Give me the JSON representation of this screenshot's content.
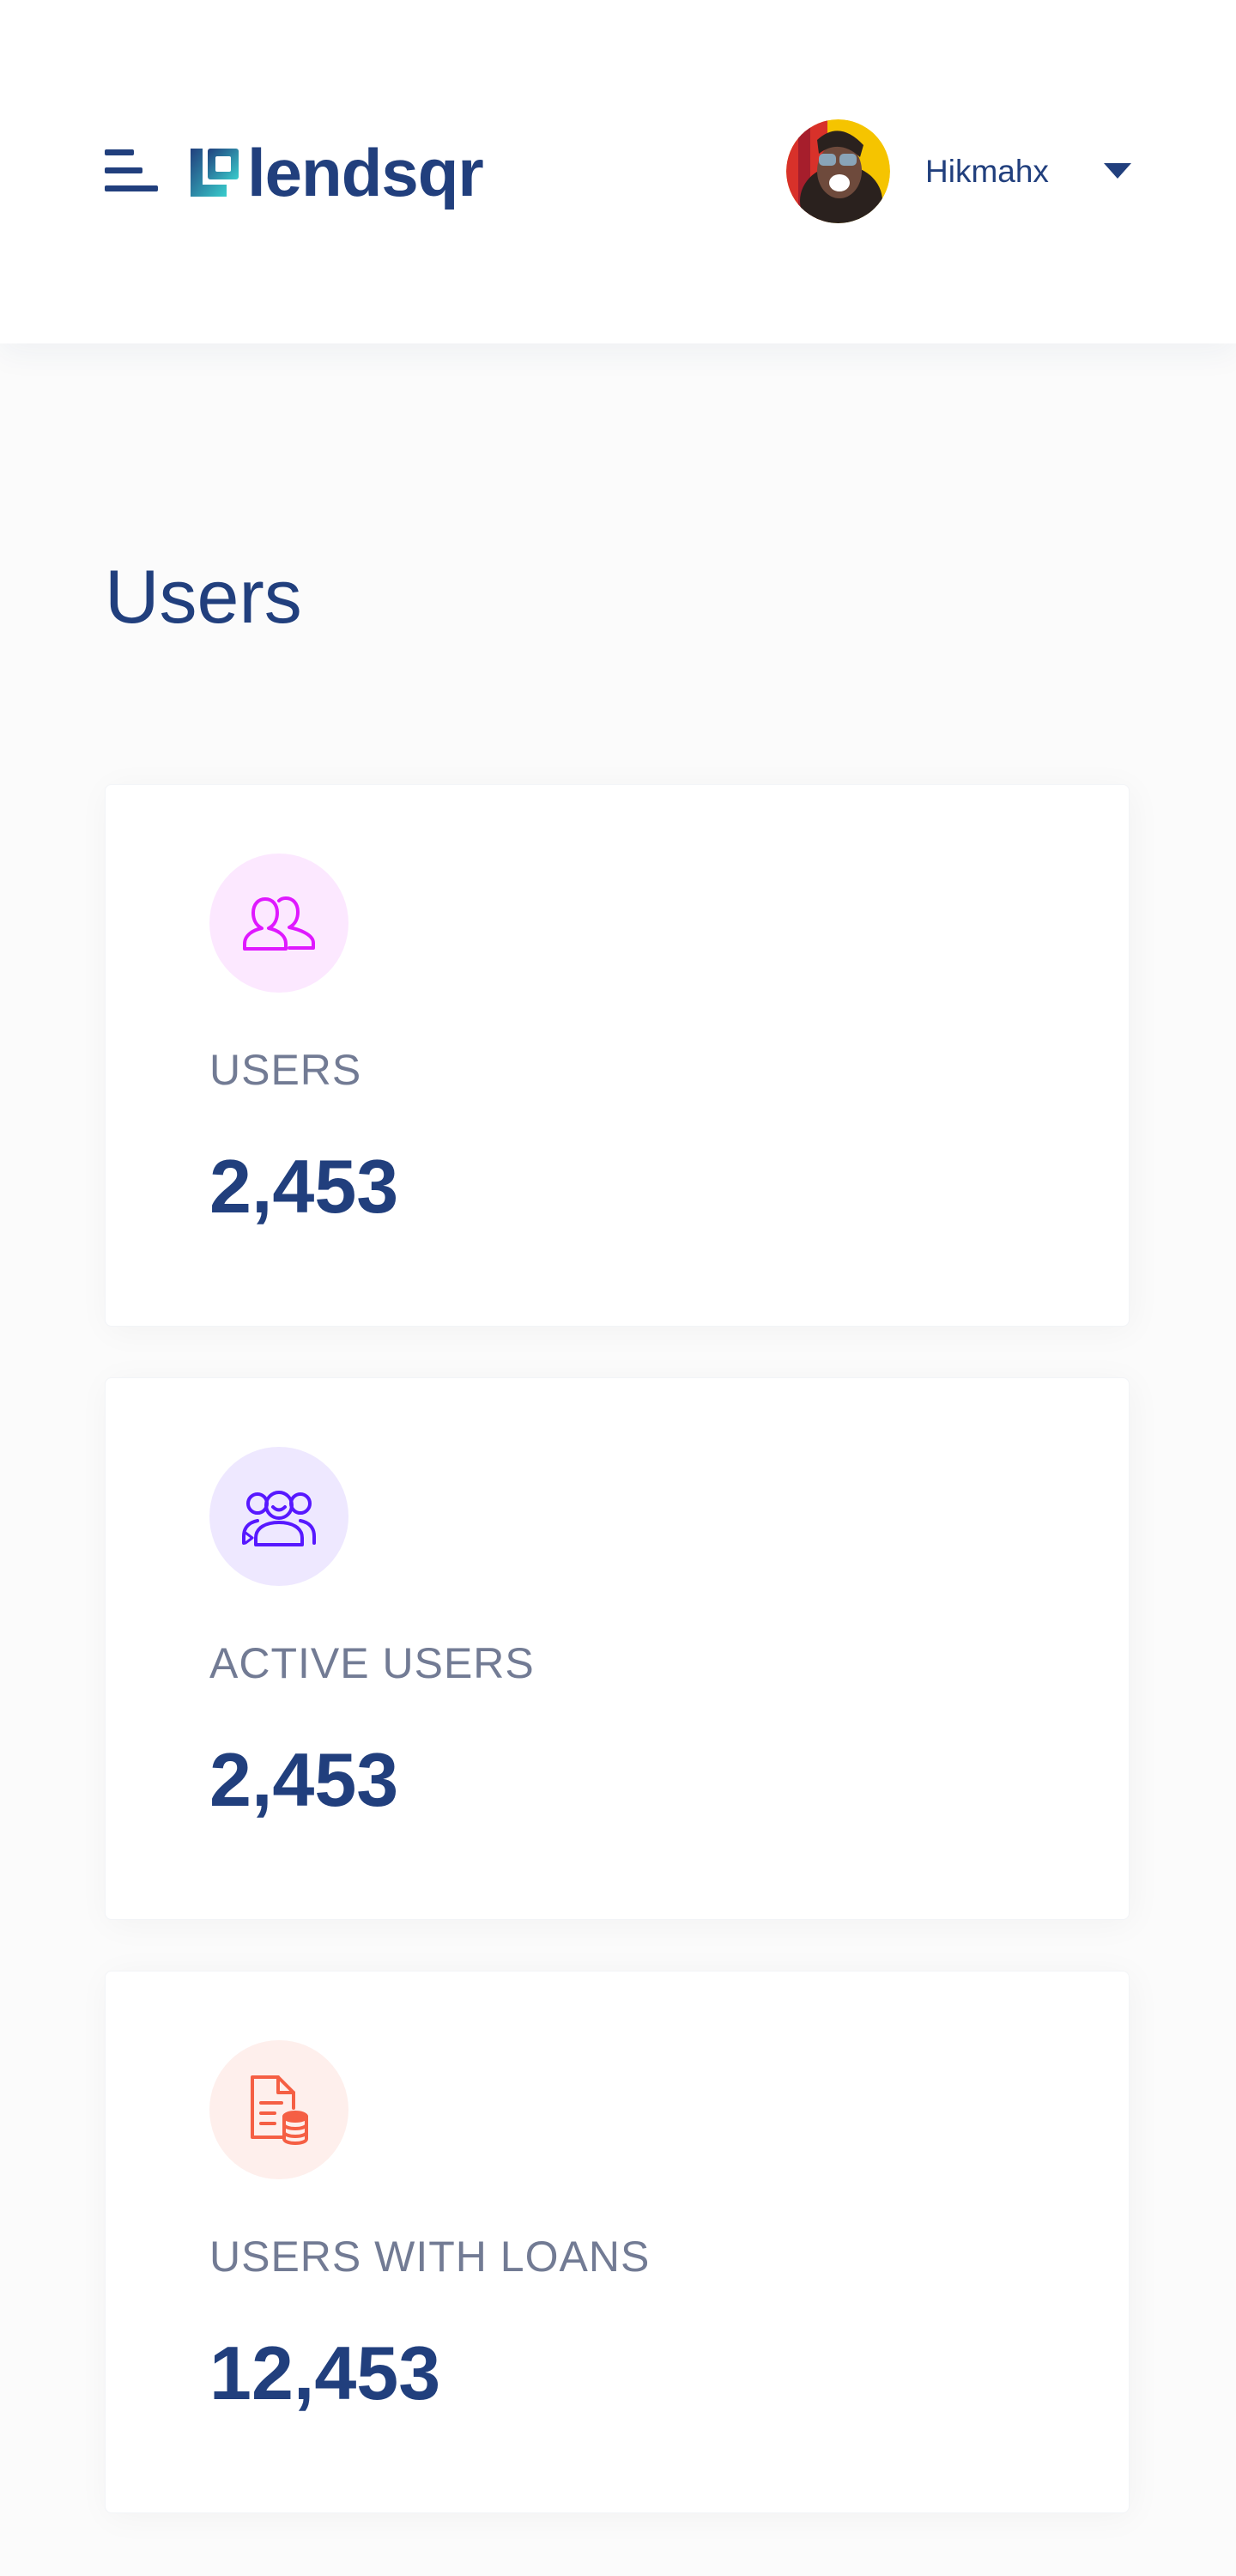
{
  "header": {
    "brand": "lendsqr",
    "user": {
      "name": "Hikmahx"
    }
  },
  "page": {
    "title": "Users"
  },
  "stats": [
    {
      "label": "USERS",
      "value": "2,453",
      "icon": "users-icon",
      "icon_color": "#DF18FF",
      "icon_bg": "#FCE8FF"
    },
    {
      "label": "ACTIVE USERS",
      "value": "2,453",
      "icon": "active-users-icon",
      "icon_color": "#5718FF",
      "icon_bg": "#EEE8FF"
    },
    {
      "label": "USERS WITH LOANS",
      "value": "12,453",
      "icon": "loans-icon",
      "icon_color": "#F55F44",
      "icon_bg": "#FEEFEC"
    }
  ],
  "colors": {
    "primary": "#213F7D",
    "label": "#545F7D",
    "accent": "#39CDCC",
    "background": "#FBFBFB"
  }
}
